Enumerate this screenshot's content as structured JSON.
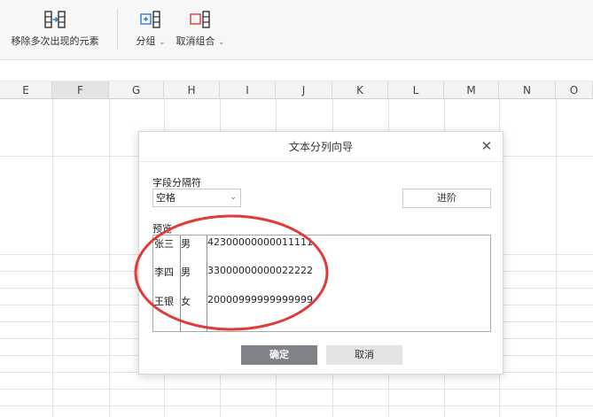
{
  "ribbon": {
    "remove_dup_label": "移除多次出现的元素",
    "group_label": "分组",
    "ungroup_label": "取消组合",
    "dropdown_glyph": "⌄"
  },
  "sheet": {
    "columns": [
      "E",
      "F",
      "G",
      "H",
      "I",
      "J",
      "K",
      "L",
      "M",
      "N",
      "O"
    ],
    "selected_column": "F"
  },
  "dialog": {
    "title": "文本分列向导",
    "close_glyph": "✕",
    "delimiter_label": "字段分隔符",
    "delimiter_value": "空格",
    "advanced_label": "进阶",
    "preview_label": "预览",
    "preview_rows": [
      [
        "张三",
        "男",
        "42300000000011111"
      ],
      [
        "李四",
        "男",
        "33000000000022222"
      ],
      [
        "王银",
        "女",
        "20000999999999999"
      ]
    ],
    "ok_label": "确定",
    "cancel_label": "取消"
  },
  "colors": {
    "annotation": "#e03a3a",
    "ok_button": "#7e8287",
    "icon_blue": "#2b7fd3",
    "icon_red": "#e03a3a"
  }
}
